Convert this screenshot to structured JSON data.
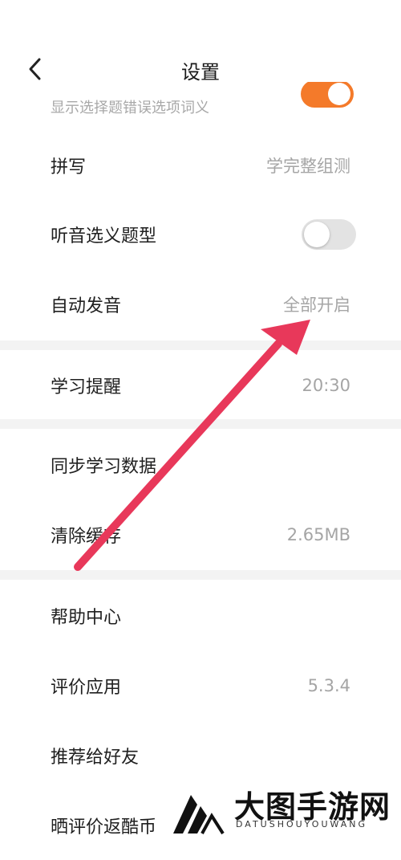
{
  "header": {
    "title": "设置",
    "back_icon": "chevron-left-icon"
  },
  "partial_row": {
    "subtitle": "显示选择题错误选项词义",
    "toggle_on": true,
    "accent_color": "#f47a2a"
  },
  "settings": [
    {
      "label": "拼写",
      "value": "学完整组测"
    },
    {
      "label": "听音选义题型",
      "toggle_on": false
    },
    {
      "label": "自动发音",
      "value": "全部开启"
    },
    {
      "label": "学习提醒",
      "value": "20:30"
    },
    {
      "label": "同步学习数据",
      "value": ""
    },
    {
      "label": "清除缓存",
      "value": "2.65MB"
    },
    {
      "label": "帮助中心",
      "value": ""
    },
    {
      "label": "评价应用",
      "value": "5.3.4"
    },
    {
      "label": "推荐给好友",
      "value": ""
    },
    {
      "label": "晒评价返酷币",
      "value": ""
    }
  ],
  "overlay": {
    "arrow_color": "#e8385a"
  },
  "watermark": {
    "title": "大图手游网",
    "subtitle": "DATUSHOUYOUWANG"
  }
}
